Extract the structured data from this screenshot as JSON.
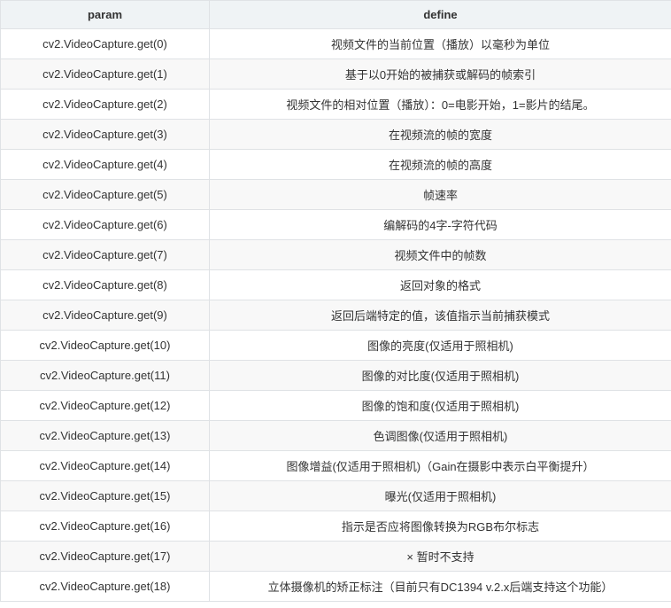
{
  "table": {
    "headers": [
      "param",
      "define"
    ],
    "rows": [
      [
        "cv2.VideoCapture.get(0)",
        "视频文件的当前位置（播放）以毫秒为单位"
      ],
      [
        "cv2.VideoCapture.get(1)",
        "基于以0开始的被捕获或解码的帧索引"
      ],
      [
        "cv2.VideoCapture.get(2)",
        "视频文件的相对位置（播放）：0=电影开始，1=影片的结尾。"
      ],
      [
        "cv2.VideoCapture.get(3)",
        "在视频流的帧的宽度"
      ],
      [
        "cv2.VideoCapture.get(4)",
        "在视频流的帧的高度"
      ],
      [
        "cv2.VideoCapture.get(5)",
        "帧速率"
      ],
      [
        "cv2.VideoCapture.get(6)",
        "编解码的4字-字符代码"
      ],
      [
        "cv2.VideoCapture.get(7)",
        "视频文件中的帧数"
      ],
      [
        "cv2.VideoCapture.get(8)",
        "返回对象的格式"
      ],
      [
        "cv2.VideoCapture.get(9)",
        "返回后端特定的值，该值指示当前捕获模式"
      ],
      [
        "cv2.VideoCapture.get(10)",
        "图像的亮度(仅适用于照相机)"
      ],
      [
        "cv2.VideoCapture.get(11)",
        "图像的对比度(仅适用于照相机)"
      ],
      [
        "cv2.VideoCapture.get(12)",
        "图像的饱和度(仅适用于照相机)"
      ],
      [
        "cv2.VideoCapture.get(13)",
        "色调图像(仅适用于照相机)"
      ],
      [
        "cv2.VideoCapture.get(14)",
        "图像增益(仅适用于照相机)（Gain在摄影中表示白平衡提升）"
      ],
      [
        "cv2.VideoCapture.get(15)",
        "曝光(仅适用于照相机)"
      ],
      [
        "cv2.VideoCapture.get(16)",
        "指示是否应将图像转换为RGB布尔标志"
      ],
      [
        "cv2.VideoCapture.get(17)",
        "× 暂时不支持"
      ],
      [
        "cv2.VideoCapture.get(18)",
        "立体摄像机的矫正标注（目前只有DC1394 v.2.x后端支持这个功能）"
      ]
    ]
  }
}
